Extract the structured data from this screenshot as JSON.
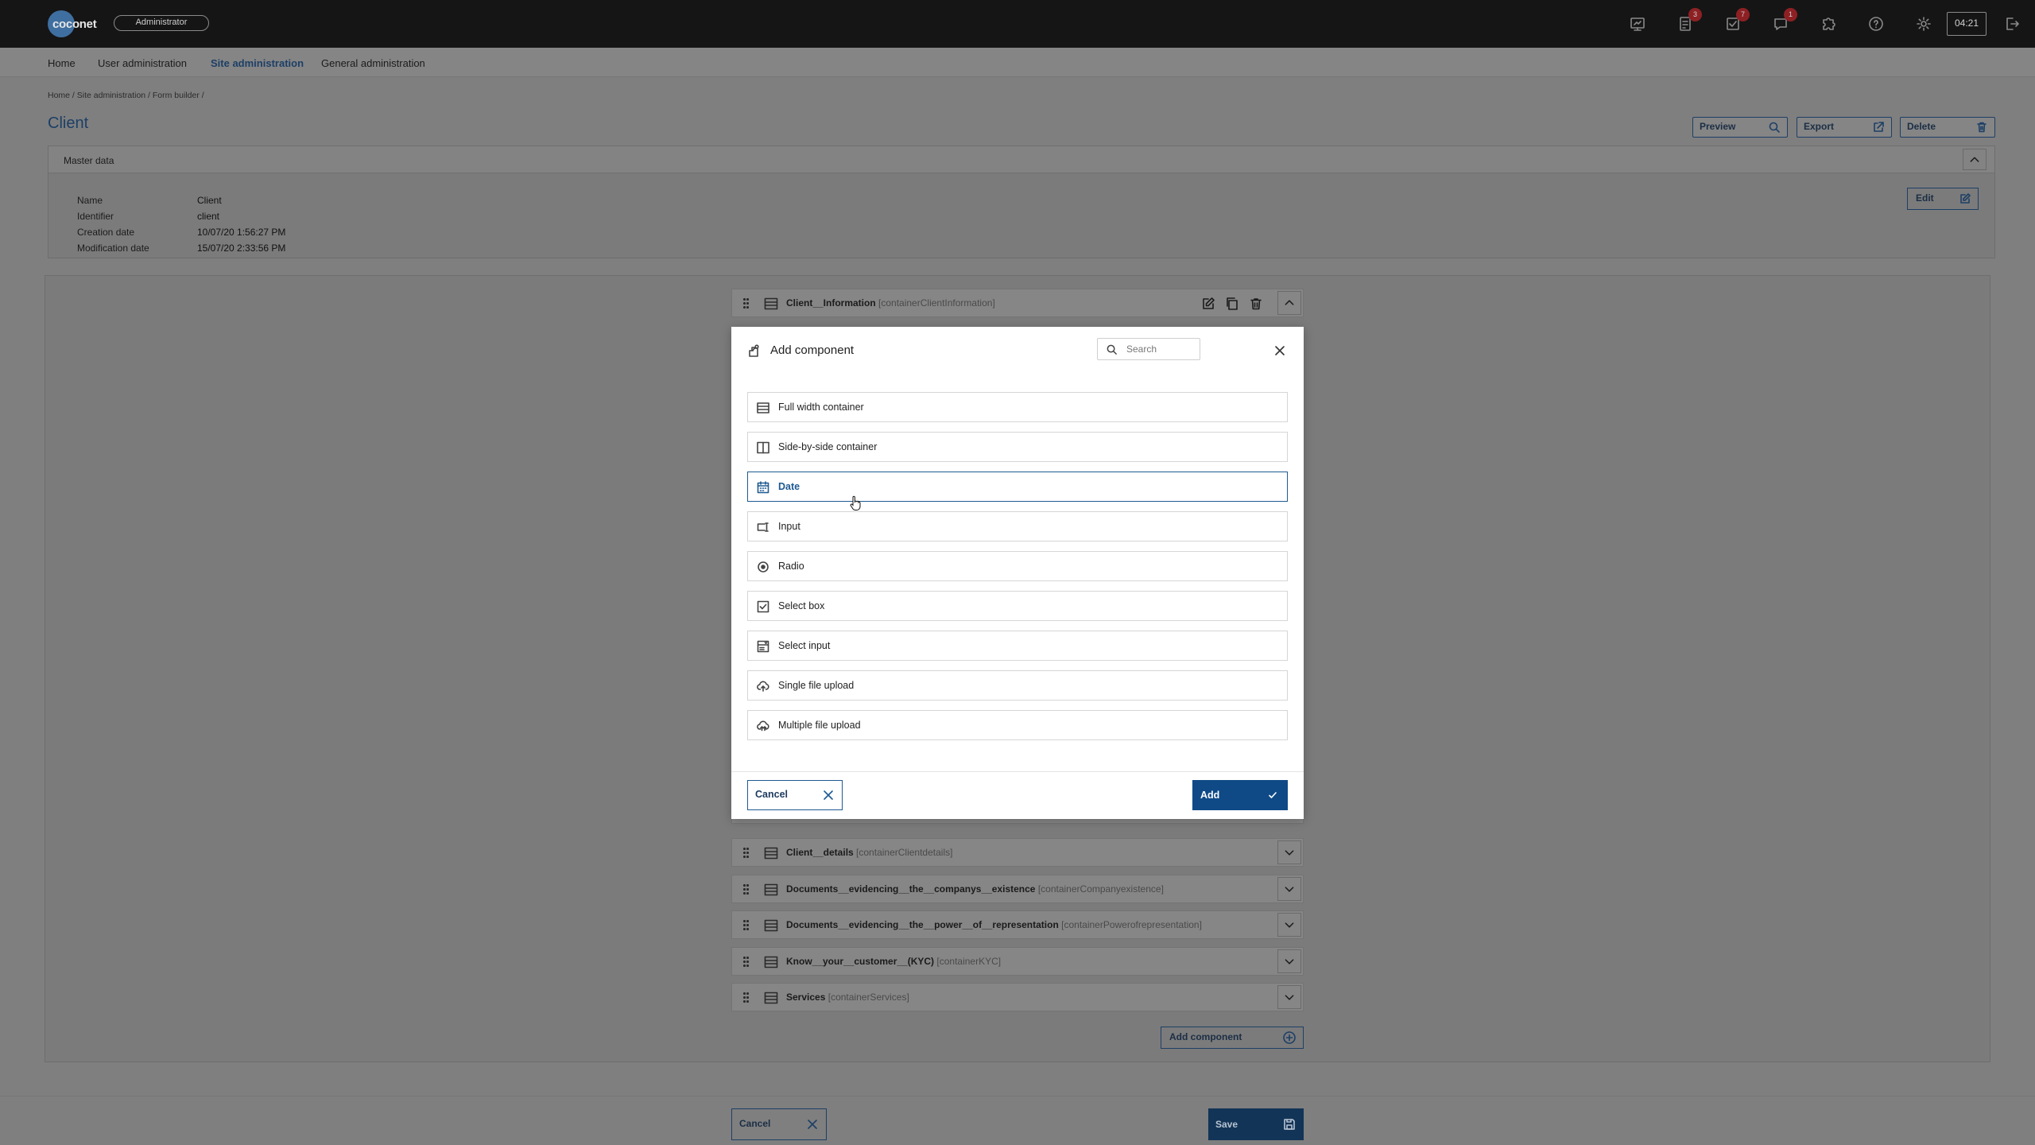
{
  "app": {
    "logo_text": "coconet",
    "role": "Administrator",
    "clock": "04:21",
    "badges": {
      "documents": "3",
      "tasks": "7",
      "messages": "1"
    }
  },
  "nav": {
    "items": [
      {
        "label": "Home"
      },
      {
        "label": "User administration"
      },
      {
        "label": "Site administration",
        "active": true
      },
      {
        "label": "General administration"
      }
    ]
  },
  "breadcrumb": "Home /  Site administration /  Form builder /",
  "page": {
    "title": "Client",
    "preview_label": "Preview",
    "export_label": "Export",
    "delete_label": "Delete"
  },
  "master_data": {
    "title": "Master data",
    "edit_label": "Edit",
    "fields": [
      {
        "label": "Name",
        "value": "Client"
      },
      {
        "label": "Identifier",
        "value": "client"
      },
      {
        "label": "Creation date",
        "value": "10/07/20 1:56:27 PM"
      },
      {
        "label": "Modification date",
        "value": "15/07/20 2:33:56 PM"
      }
    ]
  },
  "components": [
    {
      "name": "Client__Information",
      "identifier": "[containerClientInformation]"
    },
    {
      "name": "Client__details",
      "identifier": "[containerClientdetails]"
    },
    {
      "name": "Documents__evidencing__the__companys__existence",
      "identifier": "[containerCompanyexistence]"
    },
    {
      "name": "Documents__evidencing__the__power__of__representation",
      "identifier": "[containerPowerofrepresentation]"
    },
    {
      "name": "Know__your__customer__(KYC)",
      "identifier": "[containerKYC]"
    },
    {
      "name": "Services",
      "identifier": "[containerServices]"
    }
  ],
  "add_component_label": "Add component",
  "footer": {
    "cancel_label": "Cancel",
    "save_label": "Save"
  },
  "modal": {
    "title": "Add component",
    "search_placeholder": "Search",
    "options": [
      {
        "label": "Full width container",
        "icon": "full-width-container-icon"
      },
      {
        "label": "Side-by-side container",
        "icon": "side-by-side-container-icon"
      },
      {
        "label": "Date",
        "icon": "calendar-icon",
        "selected": true
      },
      {
        "label": "Input",
        "icon": "input-icon"
      },
      {
        "label": "Radio",
        "icon": "radio-icon"
      },
      {
        "label": "Select box",
        "icon": "checkbox-icon"
      },
      {
        "label": "Select input",
        "icon": "select-input-icon"
      },
      {
        "label": "Single file upload",
        "icon": "cloud-upload-icon"
      },
      {
        "label": "Multiple file upload",
        "icon": "cloud-upload-multiple-icon"
      }
    ],
    "cancel_label": "Cancel",
    "add_label": "Add"
  },
  "colors": {
    "accent": "#0f4a87",
    "topbar": "#151515",
    "badge": "#8e2024",
    "selected_border": "#1e5a92"
  }
}
